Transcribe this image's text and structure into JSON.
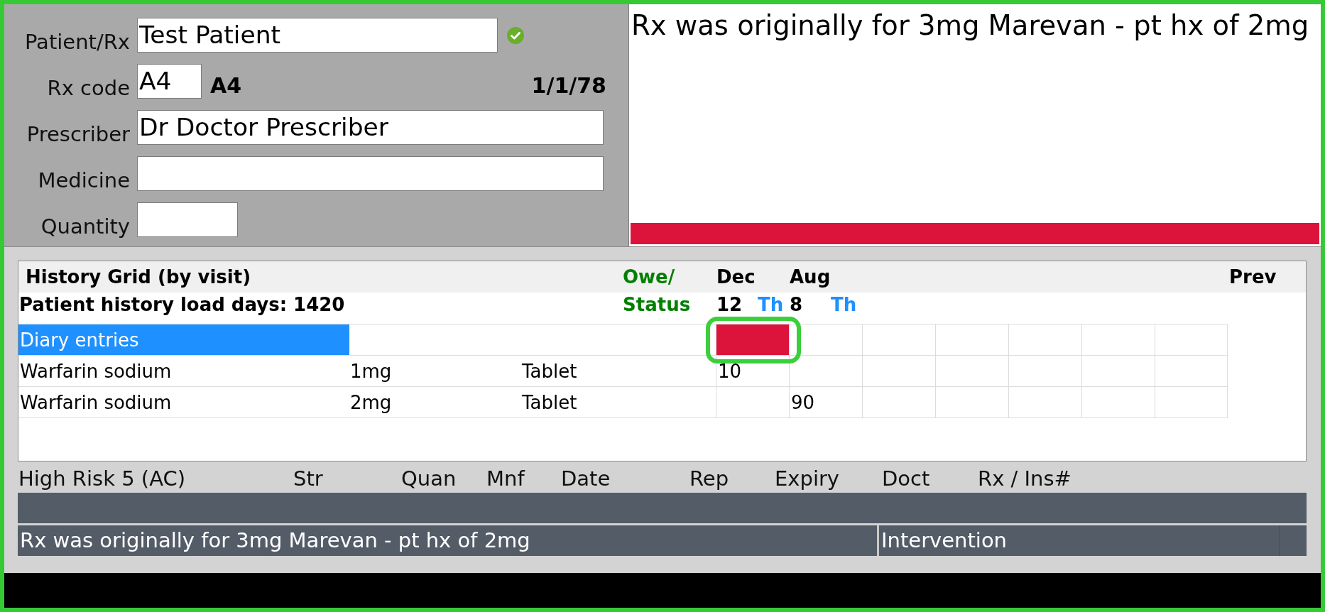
{
  "patient_form": {
    "verified": true,
    "fields": [
      {
        "kind": "wide",
        "label": "Patient/Rx",
        "value": "Test Patient"
      },
      {
        "kind": "code",
        "label": "Rx code",
        "value": "A4"
      },
      {
        "kind": "full",
        "label": "Prescriber",
        "value": "Dr Doctor Prescriber"
      },
      {
        "kind": "full",
        "label": "Medicine"
      },
      {
        "kind": "short",
        "label": "Quantity"
      }
    ],
    "rx_code_echo": "A4",
    "date": "1/1/78"
  },
  "note_panel": {
    "text": "Rx was originally for 3mg Marevan - pt hx of 2mg",
    "alert": true
  },
  "history_grid": {
    "title": "History Grid (by visit)",
    "subtitle": "Patient history load days: 1420",
    "owe_label": "Owe/",
    "status_label": "Status",
    "visits": [
      {
        "month": "Dec",
        "day": "12",
        "weekday": "Th"
      },
      {
        "month": "Aug",
        "day": "8",
        "weekday": "Th"
      }
    ],
    "prev_label": "Prev",
    "rows": [
      {
        "kind": "section",
        "name": "Diary entries",
        "selected": true,
        "cells": [
          {
            "flagged": true,
            "highlighted": true
          },
          {
            "flagged": false,
            "highlighted": false
          },
          {
            "flagged": false,
            "highlighted": false
          },
          {
            "flagged": false,
            "highlighted": false
          },
          {
            "flagged": false,
            "highlighted": false
          },
          {
            "flagged": false,
            "highlighted": false
          },
          {
            "flagged": false,
            "highlighted": false
          }
        ]
      },
      {
        "kind": "item",
        "name": "Warfarin sodium",
        "strength": "1mg",
        "form": "Tablet",
        "selected": false,
        "cells": [
          {
            "value": "10"
          },
          {},
          {},
          {},
          {},
          {},
          {}
        ]
      },
      {
        "kind": "item",
        "name": "Warfarin sodium",
        "strength": "2mg",
        "form": "Tablet",
        "selected": false,
        "cells": [
          {},
          {
            "value": "90"
          },
          {},
          {},
          {},
          {},
          {}
        ]
      }
    ]
  },
  "high_risk": {
    "columns": [
      "High Risk 5 (AC)",
      "Str",
      "Quan",
      "Mnf",
      "Date",
      "Rep",
      "Expiry",
      "Doct",
      "Rx / Ins#"
    ],
    "rows": [
      {
        "kind": "blank"
      },
      {
        "kind": "note",
        "text": "Rx was originally for 3mg Marevan - pt hx of 2mg",
        "type": "Intervention"
      }
    ]
  }
}
